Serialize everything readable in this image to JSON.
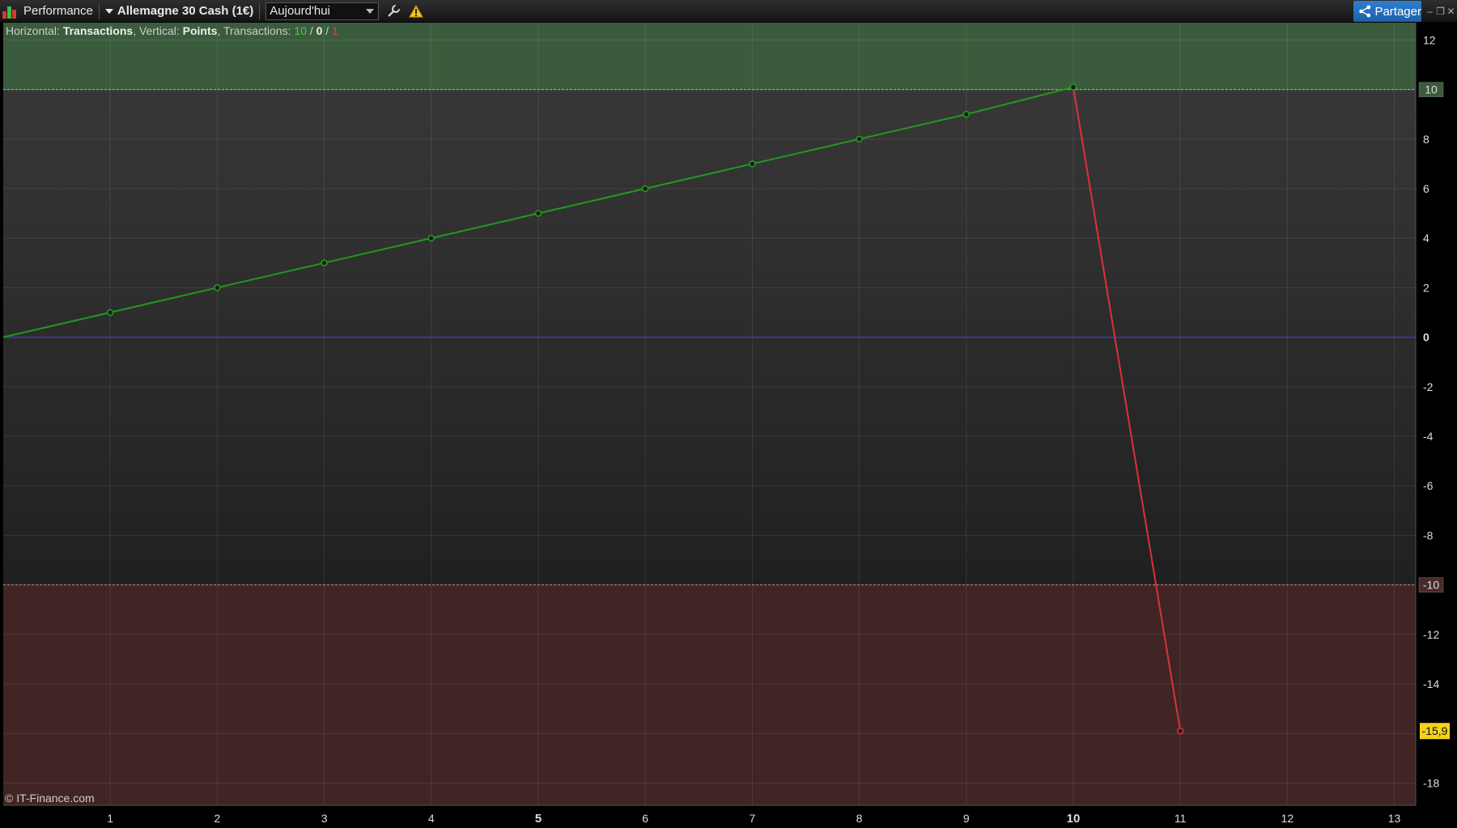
{
  "toolbar": {
    "module_label": "Performance",
    "instrument_label": "Allemagne 30 Cash (1€)",
    "period_value": "Aujourd'hui",
    "share_label": "Partager"
  },
  "info": {
    "h_prefix": "Horizontal: ",
    "h_value": "Transactions",
    "v_prefix": ", Vertical: ",
    "v_value": "Points",
    "t_prefix": ", Transactions: ",
    "wins": "10",
    "sep1": " / ",
    "neutral": "0",
    "sep2": " / ",
    "losses": "1"
  },
  "copyright": "© IT-Finance.com",
  "colors": {
    "gain_zone": "#3a5c3c",
    "loss_zone": "#412424",
    "gain_line": "#1f9a1f",
    "loss_line": "#d83434",
    "zero_line": "#3a3fa8",
    "price_tag": "#f2d21b"
  },
  "chart_data": {
    "type": "line",
    "x": [
      0,
      1,
      2,
      3,
      4,
      5,
      6,
      7,
      8,
      9,
      10,
      11
    ],
    "y": [
      0,
      1,
      2,
      3,
      4,
      5,
      6,
      7,
      8,
      9,
      10.1,
      -15.9
    ],
    "series": [
      {
        "name": "",
        "x": [
          0,
          1,
          2,
          3,
          4,
          5,
          6,
          7,
          8,
          9,
          10
        ],
        "y": [
          0,
          1,
          2,
          3,
          4,
          5,
          6,
          7,
          8,
          9,
          10.1
        ],
        "color": "#1f9a1f"
      },
      {
        "name": "",
        "x": [
          10,
          11
        ],
        "y": [
          10.1,
          -15.9
        ],
        "color": "#d83434"
      }
    ],
    "xlim": [
      0,
      13.2
    ],
    "ylim": [
      -18.9,
      12.7
    ],
    "x_ticks": [
      1,
      2,
      3,
      4,
      5,
      6,
      7,
      8,
      9,
      10,
      11,
      12,
      13
    ],
    "x_ticks_bold": [
      5,
      10
    ],
    "y_ticks": [
      12,
      10,
      8,
      6,
      4,
      2,
      0,
      -2,
      -4,
      -6,
      -8,
      -10,
      -12,
      -14,
      -16,
      -18
    ],
    "y_ticks_bold": [
      0
    ],
    "zones": {
      "gain_threshold": 10,
      "loss_threshold": -10
    },
    "last_value_label": "-15,9",
    "last_value": -15.9,
    "gain_threshold_label": "10",
    "loss_threshold_label": "-10",
    "xlabel": "Transactions",
    "ylabel": "Points",
    "grid": true
  }
}
